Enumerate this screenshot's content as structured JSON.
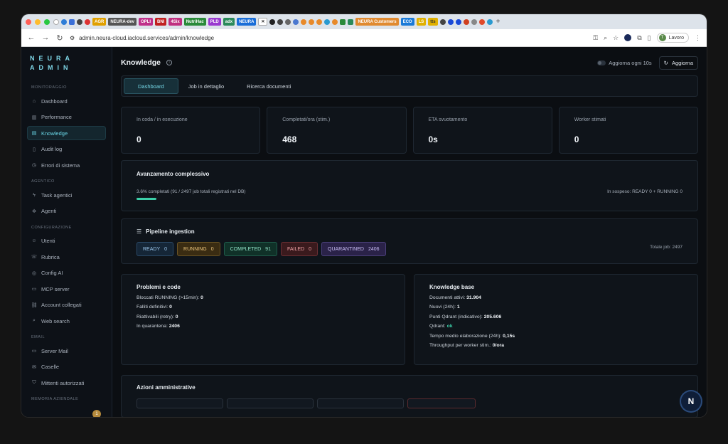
{
  "browser": {
    "tabs": [
      "AGR",
      "NEURA-dev",
      "OPLI",
      "BNI",
      "4Six",
      "NutriHac",
      "PLD",
      "adx",
      "NEURA",
      "NEURA Customers",
      "ECO",
      "LS",
      "tts"
    ],
    "url": "admin.neura-cloud.iacloud.services/admin/knowledge",
    "profile_initial": "T",
    "profile_label": "Lavoro"
  },
  "sidebar": {
    "logo_line1": "NEURA",
    "logo_line2": "ADMIN",
    "sections": {
      "monitoraggio": "MONITORAGGIO",
      "agentico": "AGENTICO",
      "configurazione": "CONFIGURAZIONE",
      "email": "EMAIL",
      "memoria": "MEMORIA AZIENDALE"
    },
    "items": {
      "dashboard": "Dashboard",
      "performance": "Performance",
      "knowledge": "Knowledge",
      "audit": "Audit log",
      "errori": "Errori di sistema",
      "task": "Task agentici",
      "agenti": "Agenti",
      "utenti": "Utenti",
      "rubrica": "Rubrica",
      "configai": "Config AI",
      "mcp": "MCP server",
      "account": "Account collegati",
      "web": "Web search",
      "mail": "Server Mail",
      "caselle": "Caselle",
      "mittenti": "Mittenti autorizzati"
    },
    "badge": "1"
  },
  "header": {
    "title": "Knowledge",
    "auto_refresh": "Aggiorna ogni 10s",
    "refresh": "Aggiorna"
  },
  "tabs": [
    "Dashboard",
    "Job in dettaglio",
    "Ricerca documenti"
  ],
  "stats": [
    {
      "label": "In coda / in esecuzione",
      "value": "0"
    },
    {
      "label": "Completati/ora (stim.)",
      "value": "468"
    },
    {
      "label": "ETA svuotamento",
      "value": "0s"
    },
    {
      "label": "Worker stimati",
      "value": "0"
    }
  ],
  "progress": {
    "title": "Avanzamento complessivo",
    "summary": "3.6% completati (91 / 2497 job totali registrati nel DB)",
    "pending": "In sospeso: READY 0 + RUNNING 0",
    "percent": 3.6
  },
  "pipeline": {
    "title": "Pipeline ingestion",
    "badges": [
      {
        "label": "READY",
        "count": "0"
      },
      {
        "label": "RUNNING",
        "count": "0"
      },
      {
        "label": "COMPLETED",
        "count": "91"
      },
      {
        "label": "FAILED",
        "count": "0"
      },
      {
        "label": "QUARANTINED",
        "count": "2406"
      }
    ],
    "total": "Totale job: 2497"
  },
  "problems": {
    "title": "Problemi e code",
    "rows": [
      {
        "label": "Bloccati RUNNING (>15min):",
        "value": "0"
      },
      {
        "label": "Falliti definitivi:",
        "value": "0"
      },
      {
        "label": "Riattivabili (retry):",
        "value": "0"
      },
      {
        "label": "In quarantena:",
        "value": "2406"
      }
    ]
  },
  "kb": {
    "title": "Knowledge base",
    "rows": [
      {
        "label": "Documenti attivi:",
        "value": "31.904"
      },
      {
        "label": "Nuovi (24h):",
        "value": "1"
      },
      {
        "label": "Punti Qdrant (indicativo):",
        "value": "205.606"
      },
      {
        "label": "Qdrant:",
        "value": "ok"
      },
      {
        "label": "Tempo medio elaborazione (24h):",
        "value": "0,15s"
      },
      {
        "label": "Throughput per worker stim.:",
        "value": "0/ora"
      }
    ]
  },
  "actions": {
    "title": "Azioni amministrative"
  },
  "fab": "N",
  "colors": {
    "accent": "#6ad6e6",
    "success": "#3ccfa8"
  }
}
